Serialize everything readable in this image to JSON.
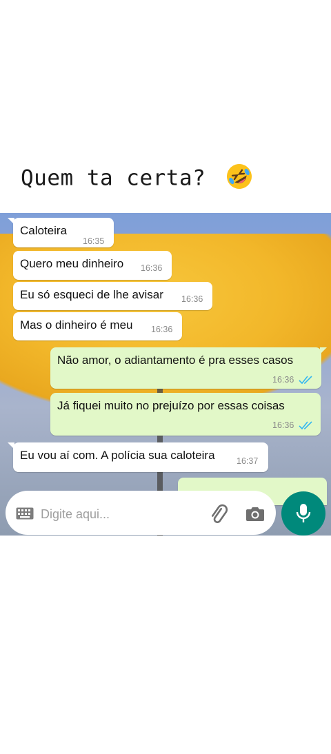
{
  "caption": {
    "text": "Quem ta certa?",
    "emoji": "rolling-on-floor-laughing-emoji"
  },
  "messages": [
    {
      "direction": "in",
      "text": "Caloteira",
      "time": "16:35"
    },
    {
      "direction": "in",
      "text": "Quero meu dinheiro",
      "time": "16:36"
    },
    {
      "direction": "in",
      "text": "Eu só esqueci de lhe avisar",
      "time": "16:36"
    },
    {
      "direction": "in",
      "text": "Mas o dinheiro é meu",
      "time": "16:36"
    },
    {
      "direction": "out",
      "text": "Não amor, o adiantamento é pra esses casos",
      "time": "16:36",
      "status": "read"
    },
    {
      "direction": "out",
      "text": "Já fiquei muito no prejuízo por essas coisas",
      "time": "16:36",
      "status": "read"
    },
    {
      "direction": "in",
      "text": "Eu vou aí com. A polícia sua caloteira",
      "time": "16:37"
    }
  ],
  "composer": {
    "placeholder": "Digite aqui...",
    "icons": [
      "keyboard-icon",
      "attach-clip-icon",
      "camera-icon",
      "microphone-icon"
    ]
  },
  "colors": {
    "incoming_bubble": "#ffffff",
    "outgoing_bubble": "#e2f8c8",
    "read_ticks": "#34b7f1",
    "mic_button": "#00897b"
  }
}
